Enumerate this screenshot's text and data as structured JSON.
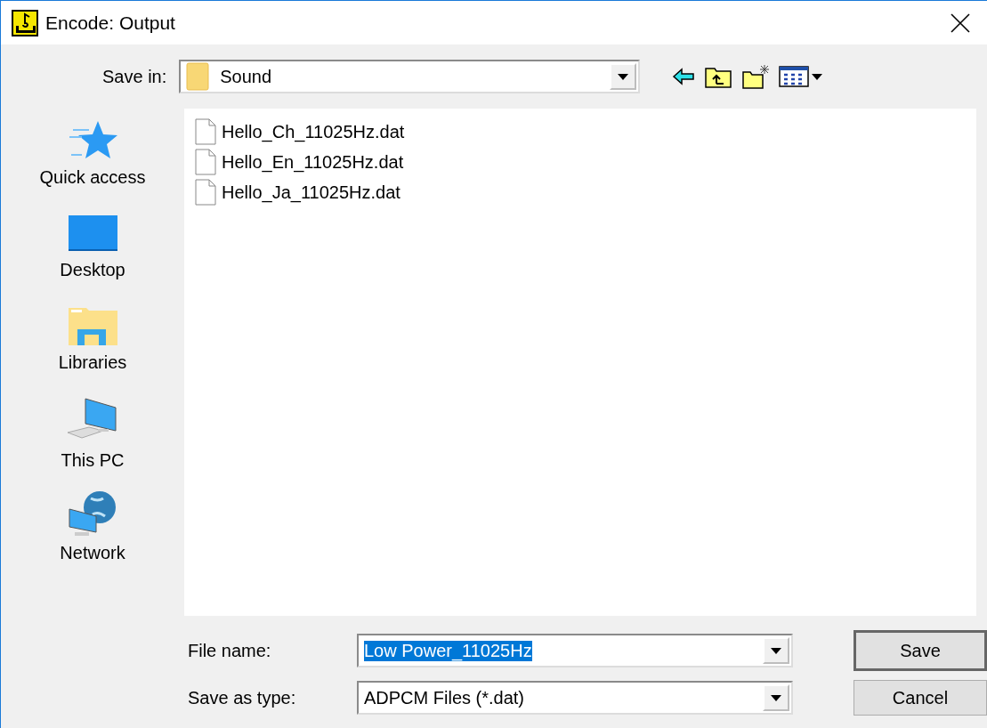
{
  "window": {
    "title": "Encode: Output"
  },
  "save_in": {
    "label": "Save in:",
    "value": "Sound"
  },
  "sidebar": {
    "items": [
      {
        "kind": "star",
        "label": "Quick access"
      },
      {
        "kind": "desktop",
        "label": "Desktop"
      },
      {
        "kind": "libraries",
        "label": "Libraries"
      },
      {
        "kind": "pc",
        "label": "This PC"
      },
      {
        "kind": "network",
        "label": "Network"
      }
    ]
  },
  "files": [
    {
      "name": "Hello_Ch_11025Hz.dat"
    },
    {
      "name": "Hello_En_11025Hz.dat"
    },
    {
      "name": "Hello_Ja_11025Hz.dat"
    }
  ],
  "file_name": {
    "label": "File name:",
    "value": "Low Power_11025Hz",
    "selected": true
  },
  "save_as_type": {
    "label": "Save as type:",
    "value": "ADPCM Files (*.dat)"
  },
  "buttons": [
    {
      "label": "Save",
      "default": true
    },
    {
      "label": "Cancel",
      "default": false
    }
  ]
}
